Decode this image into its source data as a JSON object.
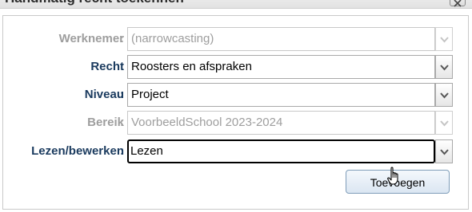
{
  "dialog": {
    "title": "Handmatig recht toekennen",
    "close_icon": "close-x-icon"
  },
  "form": {
    "werknemer": {
      "label": "Werknemer",
      "colon": ":",
      "value": "(narrowcasting)",
      "disabled": true
    },
    "recht": {
      "label": "Recht",
      "colon": ":",
      "value": "Roosters en afspraken",
      "disabled": false
    },
    "niveau": {
      "label": "Niveau",
      "colon": ":",
      "value": "Project",
      "disabled": false
    },
    "bereik": {
      "label": "Bereik",
      "colon": ":",
      "value": "VoorbeeldSchool 2023-2024",
      "disabled": true
    },
    "lezen_bewerken": {
      "label": "Lezen/bewerken",
      "colon": ":",
      "value": "Lezen",
      "disabled": false,
      "focused": true
    }
  },
  "actions": {
    "add_label": "Toevoegen"
  },
  "icons": {
    "dropdown": "chevron-down-icon",
    "cursor": "hand-pointer-icon"
  },
  "colors": {
    "label_active": "#1a3a5e",
    "label_disabled": "#9e9e9e",
    "button_border": "#7f9db9"
  }
}
